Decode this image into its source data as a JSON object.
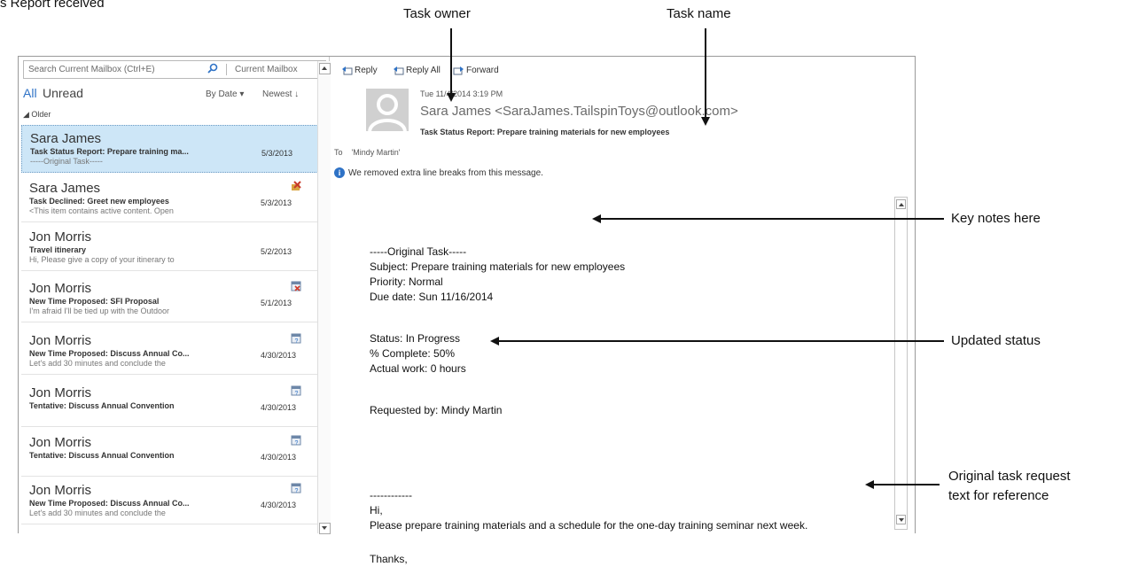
{
  "top_caption": "s Report received",
  "callouts": {
    "task_owner": "Task owner",
    "task_name": "Task name",
    "key_notes": "Key notes here",
    "updated_status": "Updated status",
    "original_line1": "Original task request",
    "original_line2": "text for reference"
  },
  "search": {
    "placeholder": "Search Current Mailbox (Ctrl+E)",
    "scope": "Current Mailbox"
  },
  "filters": {
    "all": "All",
    "unread": "Unread",
    "sort": "By Date",
    "order": "Newest"
  },
  "group_header": "Older",
  "messages": [
    {
      "sender": "Sara James",
      "subject": "Task Status Report: Prepare training ma...",
      "date": "5/3/2013",
      "preview": "-----Original Task-----",
      "icon": "none",
      "selected": true
    },
    {
      "sender": "Sara James",
      "subject": "Task Declined: Greet new employees",
      "date": "5/3/2013",
      "preview": "<This item contains active content. Open",
      "icon": "task-declined-icon"
    },
    {
      "sender": "Jon Morris",
      "subject": "Travel itinerary",
      "date": "5/2/2013",
      "preview": "Hi,  Please give a copy of your itinerary to",
      "icon": "none"
    },
    {
      "sender": "Jon Morris",
      "subject": "New Time Proposed: SFI Proposal",
      "date": "5/1/2013",
      "preview": "I'm afraid I'll be tied up with the Outdoor",
      "icon": "meeting-decline-icon"
    },
    {
      "sender": "Jon Morris",
      "subject": "New Time Proposed: Discuss Annual Co...",
      "date": "4/30/2013",
      "preview": "Let's add 30 minutes and conclude the",
      "icon": "meeting-tentative-icon"
    },
    {
      "sender": "Jon Morris",
      "subject": "Tentative: Discuss Annual Convention",
      "date": "4/30/2013",
      "preview": "",
      "icon": "meeting-tentative-icon"
    },
    {
      "sender": "Jon Morris",
      "subject": "Tentative: Discuss Annual Convention",
      "date": "4/30/2013",
      "preview": "",
      "icon": "meeting-tentative-icon"
    },
    {
      "sender": "Jon Morris",
      "subject": "New Time Proposed: Discuss Annual Co...",
      "date": "4/30/2013",
      "preview": "Let's add 30 minutes and conclude the",
      "icon": "meeting-tentative-icon"
    }
  ],
  "actions": {
    "reply": "Reply",
    "reply_all": "Reply All",
    "forward": "Forward"
  },
  "header": {
    "time": "Tue 11/4/2014 3:19 PM",
    "from": "Sara James <SaraJames.TailspinToys@outlook.com>",
    "subject": "Task Status Report: Prepare training materials for new employees",
    "to_label": "To",
    "to": "'Mindy Martin'",
    "info": "We removed extra line breaks from this message."
  },
  "body_lines": [
    "-----Original Task-----",
    "Subject: Prepare training materials for new employees",
    "Priority: Normal",
    "Due date: Sun 11/16/2014",
    "",
    "Status: In Progress",
    "% Complete: 50%",
    "Actual work: 0 hours",
    "",
    "Requested by: Mindy Martin",
    "",
    "",
    "",
    "------------",
    "Hi,",
    "Please prepare training materials and a schedule for the one-day training seminar next week.",
    "",
    "Thanks,"
  ],
  "colors": {
    "accent": "#2e72c6",
    "selected_bg": "#cde6f7"
  }
}
